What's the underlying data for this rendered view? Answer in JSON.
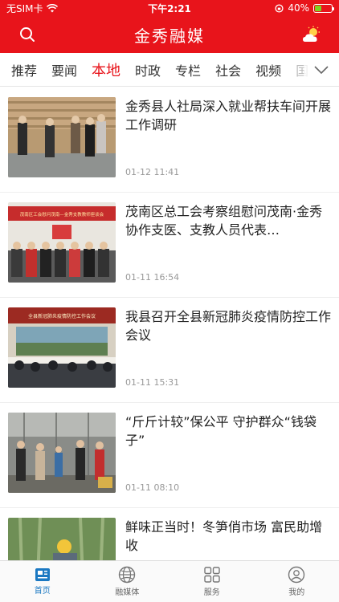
{
  "status_bar": {
    "carrier": "无SIM卡",
    "time": "下午2:21",
    "battery": "40%",
    "battery_level": 0.4
  },
  "header": {
    "title": "金秀融媒",
    "left_icon": "search-icon",
    "right_icon": "weather-icon"
  },
  "tabs": [
    "推荐",
    "要闻",
    "本地",
    "时政",
    "专栏",
    "社会",
    "视频",
    "国"
  ],
  "active_tab": "本地",
  "news": [
    {
      "title": "金秀县人社局深入就业帮扶车间开展工作调研",
      "time": "01-12 11:41"
    },
    {
      "title": "茂南区总工会考察组慰问茂南·金秀协作支医、支教人员代表…",
      "time": "01-11 16:54",
      "image_text": "茂南区工会慰问茂南—金秀支教教师座谈会"
    },
    {
      "title": "我县召开全县新冠肺炎疫情防控工作会议",
      "time": "01-11 15:31",
      "image_text": "全县新冠肺炎疫情防控工作会议"
    },
    {
      "title": "“斤斤计较”保公平 守护群众“钱袋子”",
      "time": "01-11 08:10"
    },
    {
      "title": "鲜味正当时！冬笋俏市场 富民助增收",
      "time": ""
    }
  ],
  "bottom_nav": [
    {
      "label": "首页",
      "icon": "news-icon",
      "active": true
    },
    {
      "label": "融媒体",
      "icon": "globe-icon",
      "active": false
    },
    {
      "label": "服务",
      "icon": "grid-icon",
      "active": false
    },
    {
      "label": "我的",
      "icon": "user-icon",
      "active": false
    }
  ]
}
